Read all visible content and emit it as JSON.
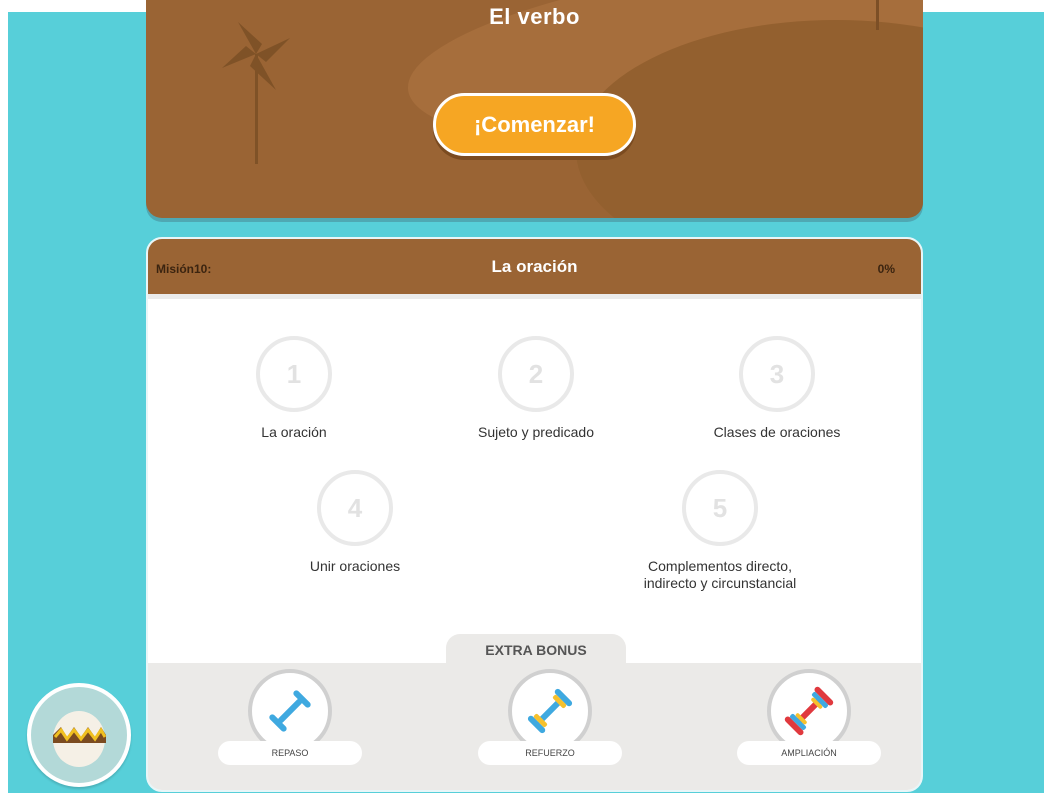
{
  "hero": {
    "title": "El verbo",
    "start_label": "¡Comenzar!",
    "color": "#9a6434",
    "button_color": "#f6a623"
  },
  "mission": {
    "label": "Misión10:",
    "title": "La oración",
    "progress": "0%",
    "lessons": [
      {
        "number": "1",
        "name": "La oración"
      },
      {
        "number": "2",
        "name": "Sujeto y predicado"
      },
      {
        "number": "3",
        "name": "Clases de oraciones"
      },
      {
        "number": "4",
        "name": "Unir oraciones"
      },
      {
        "number": "5",
        "name": "Complementos directo, indirecto y circunstancial"
      }
    ]
  },
  "bonus": {
    "title": "EXTRA BONUS",
    "items": [
      {
        "label": "REPASO",
        "icon": "dumbbell-blue-icon"
      },
      {
        "label": "REFUERZO",
        "icon": "dumbbell-blue-yellow-icon"
      },
      {
        "label": "AMPLIACIÓN",
        "icon": "dumbbell-multicolor-icon"
      }
    ]
  },
  "avatar": {
    "icon": "hatching-egg-icon"
  },
  "colors": {
    "background": "#57cfd9",
    "brown": "#9a6434",
    "orange": "#f6a623"
  }
}
